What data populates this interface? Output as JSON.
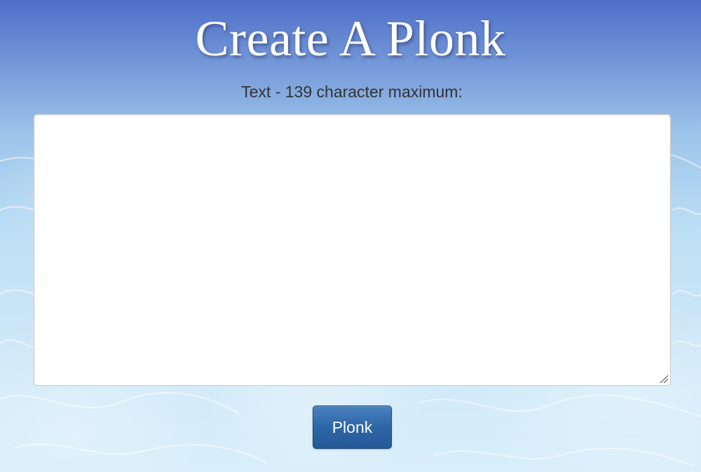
{
  "page": {
    "title": "Create A Plonk"
  },
  "form": {
    "text_label": "Text - 139 character maximum:",
    "text_value": "",
    "submit_label": "Plonk"
  },
  "colors": {
    "button": "#2d66a6",
    "title_text": "#ffffff",
    "label_text": "#333333",
    "background_top": "#4f6fc8",
    "background_bottom": "#d8eefa"
  },
  "icons": {
    "resize_handle": "resize-handle-icon"
  }
}
